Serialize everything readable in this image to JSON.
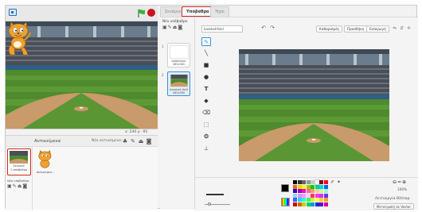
{
  "stage": {
    "coords": "x: 240  y: -95"
  },
  "sprites_pane": {
    "title": "Αντικείμενα",
    "new_sprite_label": "Νέο αντικείμενο:",
    "stage_thumb_label": "Σκηνικό\n1 υπόβαθρο",
    "new_backdrop_label": "Νέο υπόβαθρο:",
    "sprite_name": "Αντικείμεν..."
  },
  "tabs": [
    {
      "label": "Σενάρια"
    },
    {
      "label": "Υπόβαθρα"
    },
    {
      "label": "Ήχοι"
    }
  ],
  "costume_list": {
    "title": "Νέο υπόβαθρο",
    "items": [
      {
        "num": "1",
        "name": "υπόβαθρο1",
        "size": "480x360"
      },
      {
        "num": "2",
        "name": "baseball-field",
        "size": "480x360"
      }
    ]
  },
  "editor": {
    "name_value": "baseball-field",
    "buttons": {
      "clear": "Καθαρισμός",
      "add": "Προσθήκη",
      "import": "Εισαγωγή"
    },
    "zoom_level": "100%",
    "mode_label": "Λειτουργία Bitmap",
    "convert_button": "Μετατροπή σε Vector"
  },
  "colors": {
    "accent_red": "#d7261e",
    "selection_blue": "#3b8fd6",
    "grass": "#4f8a2e",
    "dirt": "#c99a6a"
  },
  "icons": [
    "fullscreen-icon",
    "green-flag-icon",
    "stop-icon",
    "paintbrush-icon",
    "line-icon",
    "rectangle-icon",
    "ellipse-icon",
    "text-icon",
    "fill-icon",
    "eraser-icon",
    "select-icon",
    "stamp-icon",
    "set-center-icon",
    "undo-icon",
    "redo-icon",
    "zoom-in-icon",
    "zoom-out-icon"
  ]
}
